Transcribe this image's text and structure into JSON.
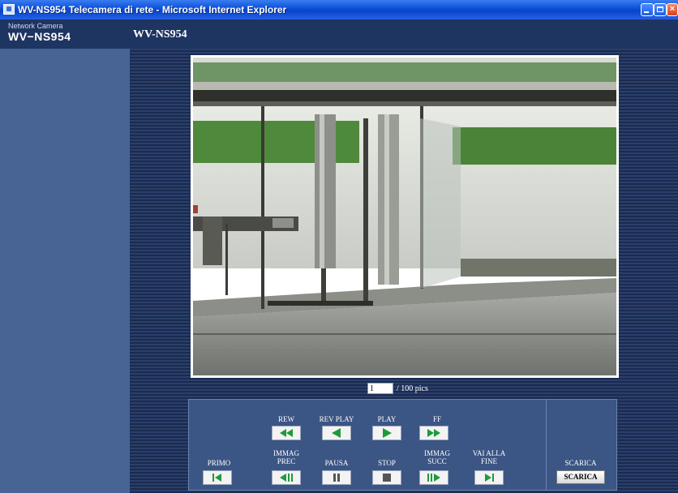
{
  "window": {
    "title": "WV-NS954 Telecamera di rete - Microsoft Internet Explorer",
    "icon": "ie-icon",
    "buttons": [
      "minimize-icon",
      "maximize-icon",
      "close-icon"
    ]
  },
  "brand": {
    "subtitle": "Network Camera",
    "model": "WV−NS954"
  },
  "header": {
    "title": "WV-NS954"
  },
  "counter": {
    "value": "1",
    "total_label": "/ 100 pics"
  },
  "controls": {
    "rew": "REW",
    "rev_play": "REV PLAY",
    "play": "PLAY",
    "ff": "FF",
    "first": "PRIMO",
    "prev_1": "IMMAG",
    "prev_2": "PREC",
    "pause": "PAUSA",
    "stop": "STOP",
    "next_1": "IMMAG",
    "next_2": "SUCC",
    "last_1": "VAI ALLA",
    "last_2": "FINE"
  },
  "download": {
    "label": "SCARICA",
    "button": "SCARICA"
  },
  "colors": {
    "page_bg": "#1c2d52",
    "sidebar": "#476494",
    "panel": "#3b5584",
    "button_icon": "#1f9a3a"
  }
}
